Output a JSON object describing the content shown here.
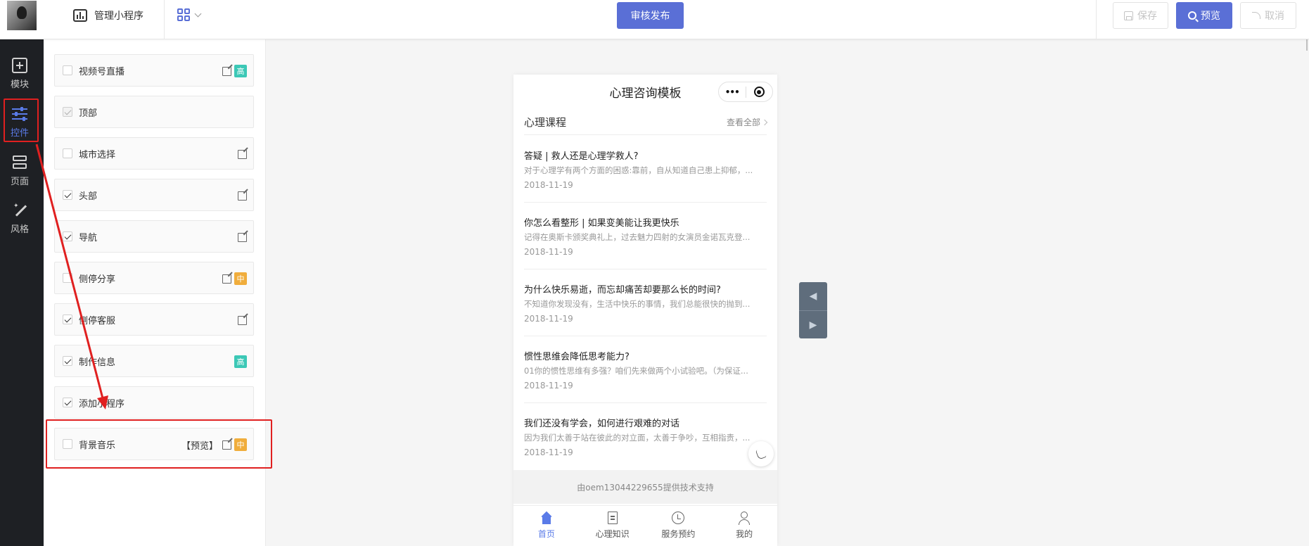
{
  "header": {
    "manage_label": "管理小程序",
    "publish_label": "审核发布",
    "save_label": "保存",
    "preview_label": "预览",
    "cancel_label": "取消"
  },
  "rail": {
    "items": [
      {
        "label": "模块",
        "icon": "plus-square-icon"
      },
      {
        "label": "控件",
        "icon": "sliders-icon",
        "active": true
      },
      {
        "label": "页面",
        "icon": "layers-icon"
      },
      {
        "label": "风格",
        "icon": "magic-wand-icon"
      }
    ]
  },
  "controls": [
    {
      "label": "视频号直播",
      "checked": false,
      "edit": true,
      "tag": "高"
    },
    {
      "label": "顶部",
      "checked": true,
      "disabled": true,
      "edit": false,
      "tag": ""
    },
    {
      "label": "城市选择",
      "checked": false,
      "edit": true,
      "tag": ""
    },
    {
      "label": "头部",
      "checked": true,
      "edit": true,
      "tag": ""
    },
    {
      "label": "导航",
      "checked": true,
      "edit": true,
      "tag": ""
    },
    {
      "label": "侧停分享",
      "checked": false,
      "edit": true,
      "tag": "中"
    },
    {
      "label": "侧停客服",
      "checked": true,
      "edit": true,
      "tag": ""
    },
    {
      "label": "制作信息",
      "checked": true,
      "edit": false,
      "tag": "高"
    },
    {
      "label": "添加小程序",
      "checked": true,
      "edit": false,
      "tag": ""
    },
    {
      "label": "背景音乐",
      "checked": false,
      "edit": true,
      "tag": "中",
      "preview": "【预览】"
    }
  ],
  "phone": {
    "title": "心理咨询模板",
    "section_title": "心理课程",
    "see_all": "查看全部",
    "articles": [
      {
        "title": "答疑 | 救人还是心理学救人?",
        "desc": "对于心理学有两个方面的困惑:靠前，自从知道自己患上抑郁，...",
        "date": "2018-11-19"
      },
      {
        "title": "你怎么看整形 | 如果变美能让我更快乐",
        "desc": "记得在奥斯卡颁奖典礼上，过去魅力四射的女演员金诺瓦克登...",
        "date": "2018-11-19"
      },
      {
        "title": "为什么快乐易逝，而忘却痛苦却要那么长的时间?",
        "desc": "不知道你发现没有，生活中快乐的事情，我们总能很快的抛到...",
        "date": "2018-11-19"
      },
      {
        "title": "惯性思维会降低思考能力?",
        "desc": "01你的惯性思维有多强？咱们先来做两个小试验吧。（为保证...",
        "date": "2018-11-19"
      },
      {
        "title": "我们还没有学会，如何进行艰难的对话",
        "desc": "因为我们太善于站在彼此的对立面，太善于争吵，互相指责，...",
        "date": "2018-11-19"
      }
    ],
    "footer": "由oem13044229655提供技术支持",
    "tabs": [
      {
        "label": "首页",
        "icon": "home-icon",
        "active": true
      },
      {
        "label": "心理知识",
        "icon": "book-icon"
      },
      {
        "label": "服务预约",
        "icon": "clock-icon"
      },
      {
        "label": "我的",
        "icon": "user-icon"
      }
    ]
  },
  "colors": {
    "accent": "#5a6fd6",
    "rail_bg": "#1e2024",
    "tag_high": "#3cc8b6",
    "tag_mid": "#f0ad3c",
    "highlight": "#e02020"
  }
}
